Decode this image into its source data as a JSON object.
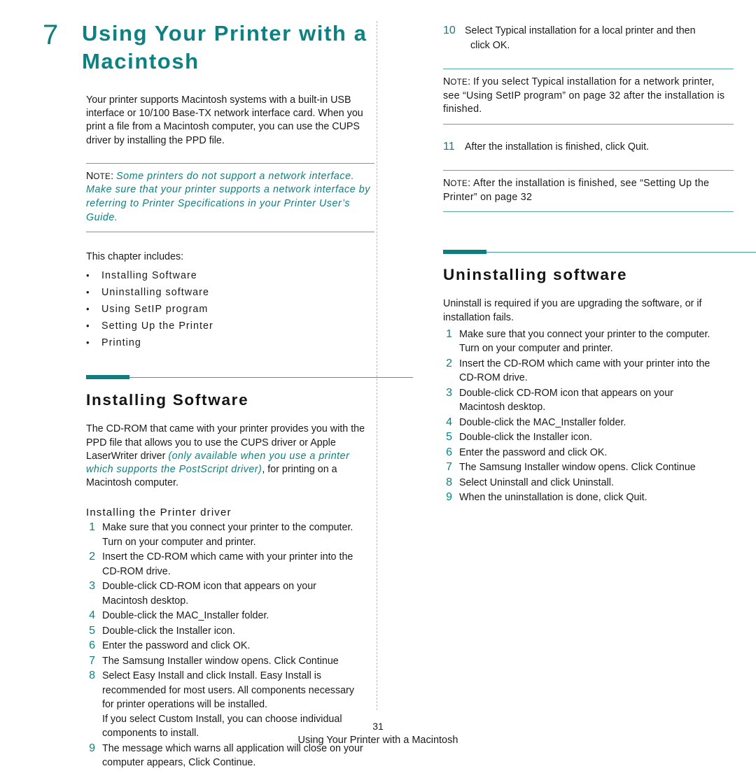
{
  "document": {
    "chapter_number": "7",
    "chapter_title": "Using Your Printer with a Macintosh",
    "footer_page_number": "31",
    "footer_title": "Using Your Printer with a Macintosh",
    "accent_teal": "#0d8181",
    "rule_teal_dark": "#0d7d7d",
    "rule_teal_light": "#59a8a8"
  },
  "left_column": {
    "intro_paragraph": "Your printer supports Macintosh systems with a built-in USB interface or 10/100 Base-TX network interface card. When you print a file from a Macintosh computer, you can use the CUPS driver by installing the PPD file.",
    "note": {
      "label": "N",
      "label_rest": "OTE",
      "label_colon": ":",
      "body": "Some printers do not support a network interface. Make sure that your printer supports a network interface by referring to Printer Specifications in your Printer User’s Guide."
    },
    "chapter_includes_label": "This chapter includes:",
    "bullets": [
      "Installing Software",
      "Uninstalling software",
      "Using SetIP program",
      "Setting Up the Printer",
      "Printing"
    ],
    "bullet_marker": "•",
    "section": {
      "title": "Installing Software",
      "paragraph_part1": "The CD-ROM that came with your printer provides you with the PPD file that allows you to use the CUPS driver or Apple LaserWriter driver ",
      "paragraph_emphasis": "(only available when you use a printer which supports the PostScript driver)",
      "paragraph_part2": ", for printing on a Macintosh computer.",
      "sub_heading": "Installing the Printer driver",
      "steps": [
        {
          "num": "1",
          "lines": [
            "Make sure that you connect your printer to the computer.",
            "Turn on your computer and printer."
          ]
        },
        {
          "num": "2",
          "lines": [
            "Insert the CD-ROM which came with your printer into the",
            "CD-ROM drive."
          ]
        },
        {
          "num": "3",
          "lines": [
            "Double-click CD-ROM icon that appears on your",
            "Macintosh desktop."
          ]
        },
        {
          "num": "4",
          "lines": [
            "Double-click the MAC_Installer folder."
          ]
        },
        {
          "num": "5",
          "lines": [
            "Double-click the Installer icon."
          ]
        },
        {
          "num": "6",
          "lines": [
            "Enter the password and click OK."
          ]
        },
        {
          "num": "7",
          "lines": [
            "The Samsung Installer window opens. Click Continue"
          ]
        },
        {
          "num": "8",
          "lines": [
            "Select Easy Install and click Install. Easy Install is",
            "recommended for most users. All components necessary",
            "for printer operations will be installed.",
            "If you select Custom Install, you can choose individual",
            "components to install."
          ]
        },
        {
          "num": "9",
          "lines": [
            "The message which warns all application will close on your",
            "computer appears, Click Continue."
          ]
        }
      ]
    }
  },
  "right_column": {
    "steps_continued": [
      {
        "num": "10",
        "lines": [
          "Select Typical installation for a local printer and then",
          "click OK."
        ]
      }
    ],
    "note_1": {
      "label": "N",
      "label_rest": "OTE",
      "label_colon": ":",
      "body": "If you select Typical installation for a network printer, see “Using SetIP program” on page 32 after the installation is finished."
    },
    "step_11": {
      "num": "11",
      "lines": [
        "After the installation is finished, click Quit."
      ]
    },
    "note_2": {
      "label": "N",
      "label_rest": "OTE",
      "label_colon": ":",
      "body": "After the installation is finished, see “Setting Up the Printer” on page 32"
    },
    "section": {
      "title": "Uninstalling software",
      "paragraph": "Uninstall is required if you are upgrading the software, or if installation fails.",
      "steps": [
        {
          "num": "1",
          "lines": [
            "Make sure that you connect your printer to the computer.",
            "Turn on your computer and printer."
          ]
        },
        {
          "num": "2",
          "lines": [
            "Insert the CD-ROM which came with your printer into the",
            "CD-ROM drive."
          ]
        },
        {
          "num": "3",
          "lines": [
            "Double-click CD-ROM icon that appears on your",
            "Macintosh desktop."
          ]
        },
        {
          "num": "4",
          "lines": [
            "Double-click the MAC_Installer folder."
          ]
        },
        {
          "num": "5",
          "lines": [
            "Double-click the Installer icon."
          ]
        },
        {
          "num": "6",
          "lines": [
            "Enter the password and click OK."
          ]
        },
        {
          "num": "7",
          "lines": [
            "The Samsung Installer window opens. Click Continue"
          ]
        },
        {
          "num": "8",
          "lines": [
            "Select Uninstall and click Uninstall."
          ]
        },
        {
          "num": "9",
          "lines": [
            "When the uninstallation is done, click Quit."
          ]
        }
      ]
    }
  }
}
